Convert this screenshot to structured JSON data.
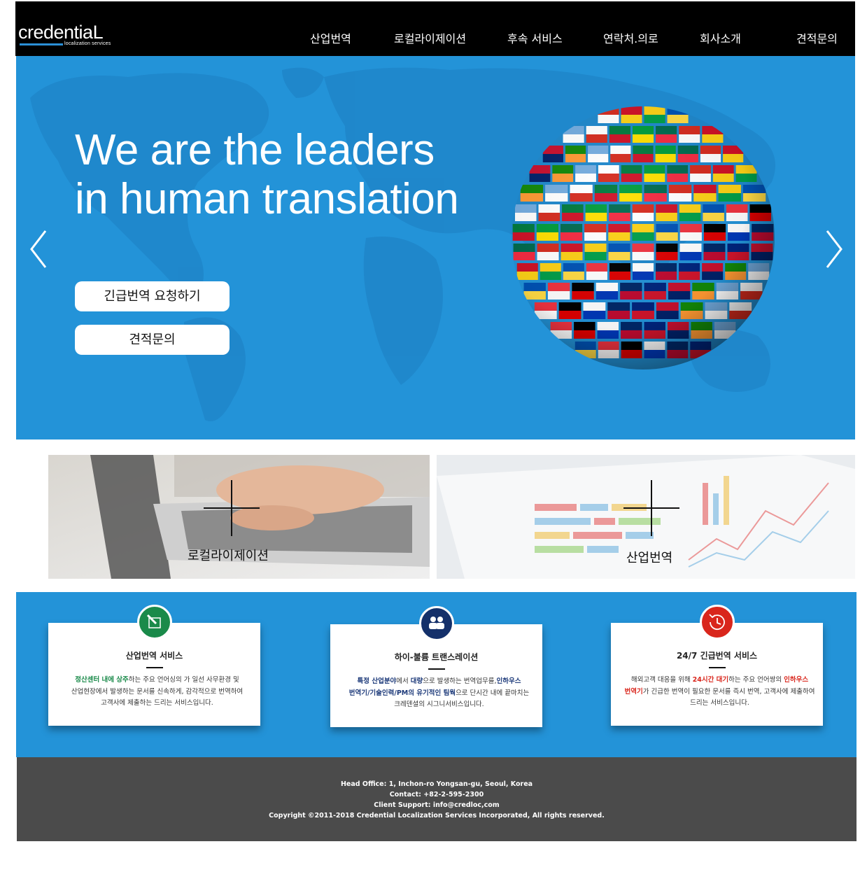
{
  "header": {
    "logo_text": "credentiaL",
    "logo_tagline": "localization services",
    "nav": [
      "산업번역",
      "로컬라이제이션",
      "후속 서비스",
      "연락처.의로",
      "회사소개",
      "견적문의"
    ]
  },
  "hero": {
    "title_line1": "We are the leaders",
    "title_line2": "in human translation",
    "button_urgent": "긴급번역 요청하기",
    "button_quote": "견적문의",
    "prev_icon": "chevron-left-icon",
    "next_icon": "chevron-right-icon"
  },
  "tiles": [
    {
      "label": "로컬라이제이션"
    },
    {
      "label": "산업번역"
    }
  ],
  "services": [
    {
      "title": "산업번역 서비스",
      "icon": "edit-icon",
      "color": "#1a8a4a",
      "body_hl": "정산센터 내에 상주",
      "body_1": "하는 주요 언어싱의  가 일선 사무환경 및",
      "body_2": "산업현장에서 발생하는 문서를 신속하게, 감각적으로 번역하여",
      "body_3": "고객사에 제출하는 드리는 서비스입니다."
    },
    {
      "title": "하이-불륨 트랜스레이션",
      "icon": "people-icon",
      "color": "#14306a",
      "body_hl1": "특정 산업분야",
      "body_a": "에서 ",
      "body_hl2": "대량",
      "body_b": "으로 발생하는 번역업무를,",
      "body_hl3": "인하우스",
      "body_hl4": "번역기/기술인력/PM의 유기적인 팀웍",
      "body_c": "으로 단시간 내에 끝마치는",
      "body_d": "크레덴셜의 시그니서비스입니다."
    },
    {
      "title": "24/7 긴급번역 서비스",
      "icon": "clock-history-icon",
      "color": "#d9261c",
      "body_a": "해외고객 대응을 위해 ",
      "body_hl1": "24시간 대기",
      "body_b": "하는 주요 언어쌍의 ",
      "body_hl2": "인하우스",
      "body_hl3": "번역기",
      "body_c": "가 긴급한 번역이 필요한 문서를 즉시 번역, 고객사에 제출하여",
      "body_d": "드리는 서비스입니다."
    }
  ],
  "footer": {
    "line1": "Head Office: 1, Inchon-ro Yongsan-gu, Seoul, Korea",
    "line2": "Contact: +82-2-595-2300",
    "line3": "Client Support: info@credloc,com",
    "line4": "Copyright ©2011-2018 Credential Localization Services Incorporated, All rights reserved."
  }
}
